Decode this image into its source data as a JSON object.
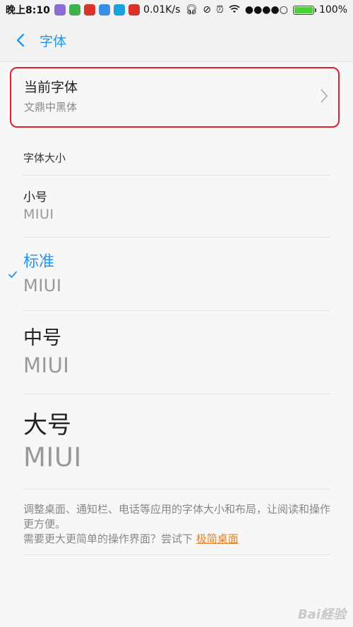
{
  "status_bar": {
    "time": "晚上8:10",
    "speed": "0.01K/s",
    "battery_level": 1.0,
    "battery_text": "100%",
    "notification_colors": [
      "#8e6bd6",
      "#3cb34a",
      "#d9322a",
      "#3a8ee6",
      "#1aa1e0",
      "#d9322a"
    ]
  },
  "header": {
    "title": "字体"
  },
  "current_font": {
    "title": "当前字体",
    "value": "文鼎中黑体"
  },
  "font_size": {
    "section_label": "字体大小",
    "options": [
      {
        "label": "小号",
        "sample": "MIUI",
        "selected": false
      },
      {
        "label": "标准",
        "sample": "MIUI",
        "selected": true
      },
      {
        "label": "中号",
        "sample": "MIUI",
        "selected": false
      },
      {
        "label": "大号",
        "sample": "MIUI",
        "selected": false
      }
    ]
  },
  "footer": {
    "line1": "调整桌面、通知栏、电话等应用的字体大小和布局，让阅读和操作更方便。",
    "line2": "需要更大更简单的操作界面？尝试下 ",
    "link": "极简桌面"
  },
  "watermark": "Bai経验",
  "colors": {
    "accent": "#2196f3",
    "highlight_border": "#e0202e",
    "link": "#e67e22"
  }
}
